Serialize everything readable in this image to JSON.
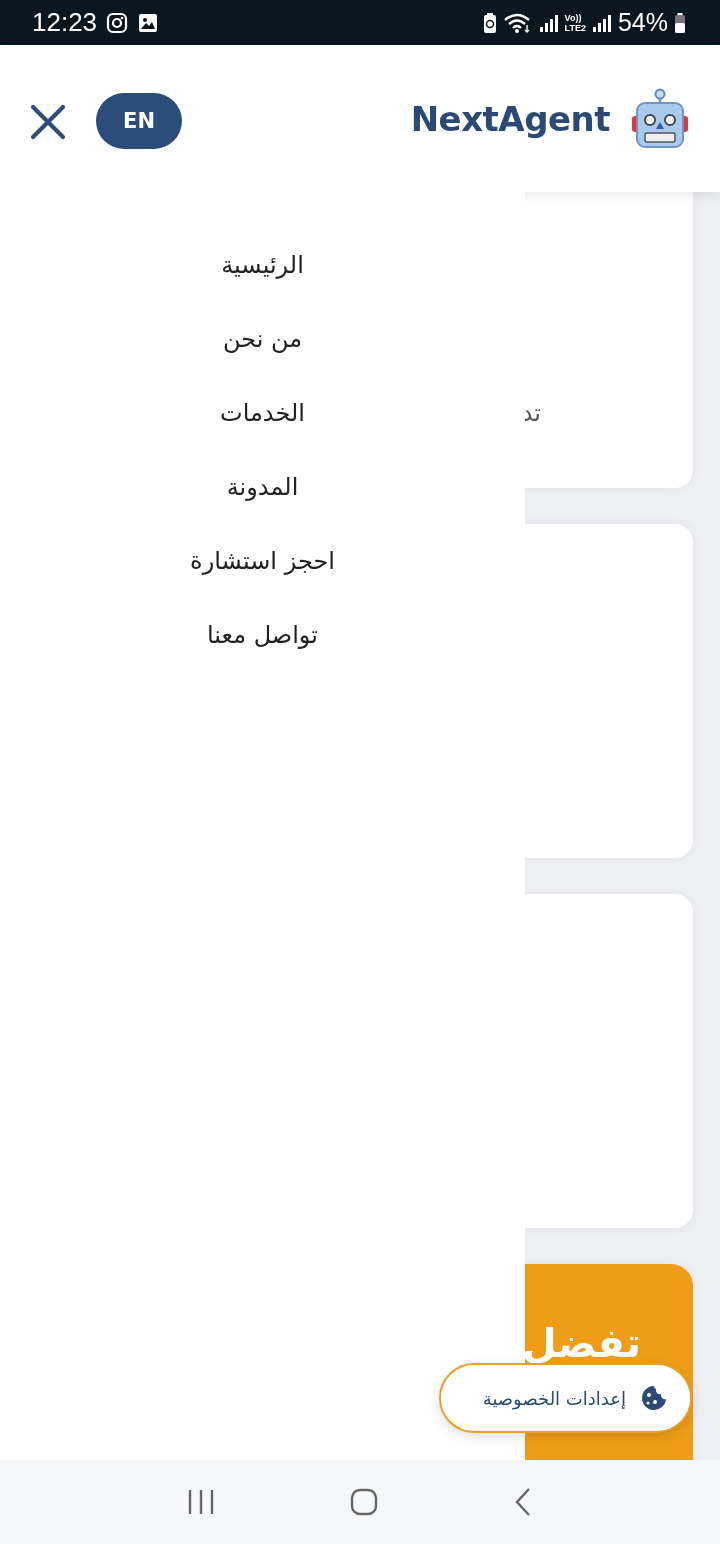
{
  "status_bar": {
    "time": "12:23",
    "network": [
      "Vo))",
      "LTE2"
    ],
    "battery": "54%"
  },
  "header": {
    "language_button": "EN",
    "brand": "NextAgent"
  },
  "menu": {
    "items": [
      {
        "label": "الرئيسية"
      },
      {
        "label": "من نحن"
      },
      {
        "label": "الخدمات"
      },
      {
        "label": "المدونة"
      },
      {
        "label": "احجز استشارة"
      },
      {
        "label": "تواصل معنا"
      }
    ]
  },
  "cards": [
    {
      "kind": "plain",
      "text": "تد"
    },
    {
      "kind": "plain"
    },
    {
      "kind": "plain"
    },
    {
      "kind": "promo",
      "text": "تفضل"
    }
  ],
  "privacy_button": {
    "label": "إعدادات الخصوصية"
  }
}
